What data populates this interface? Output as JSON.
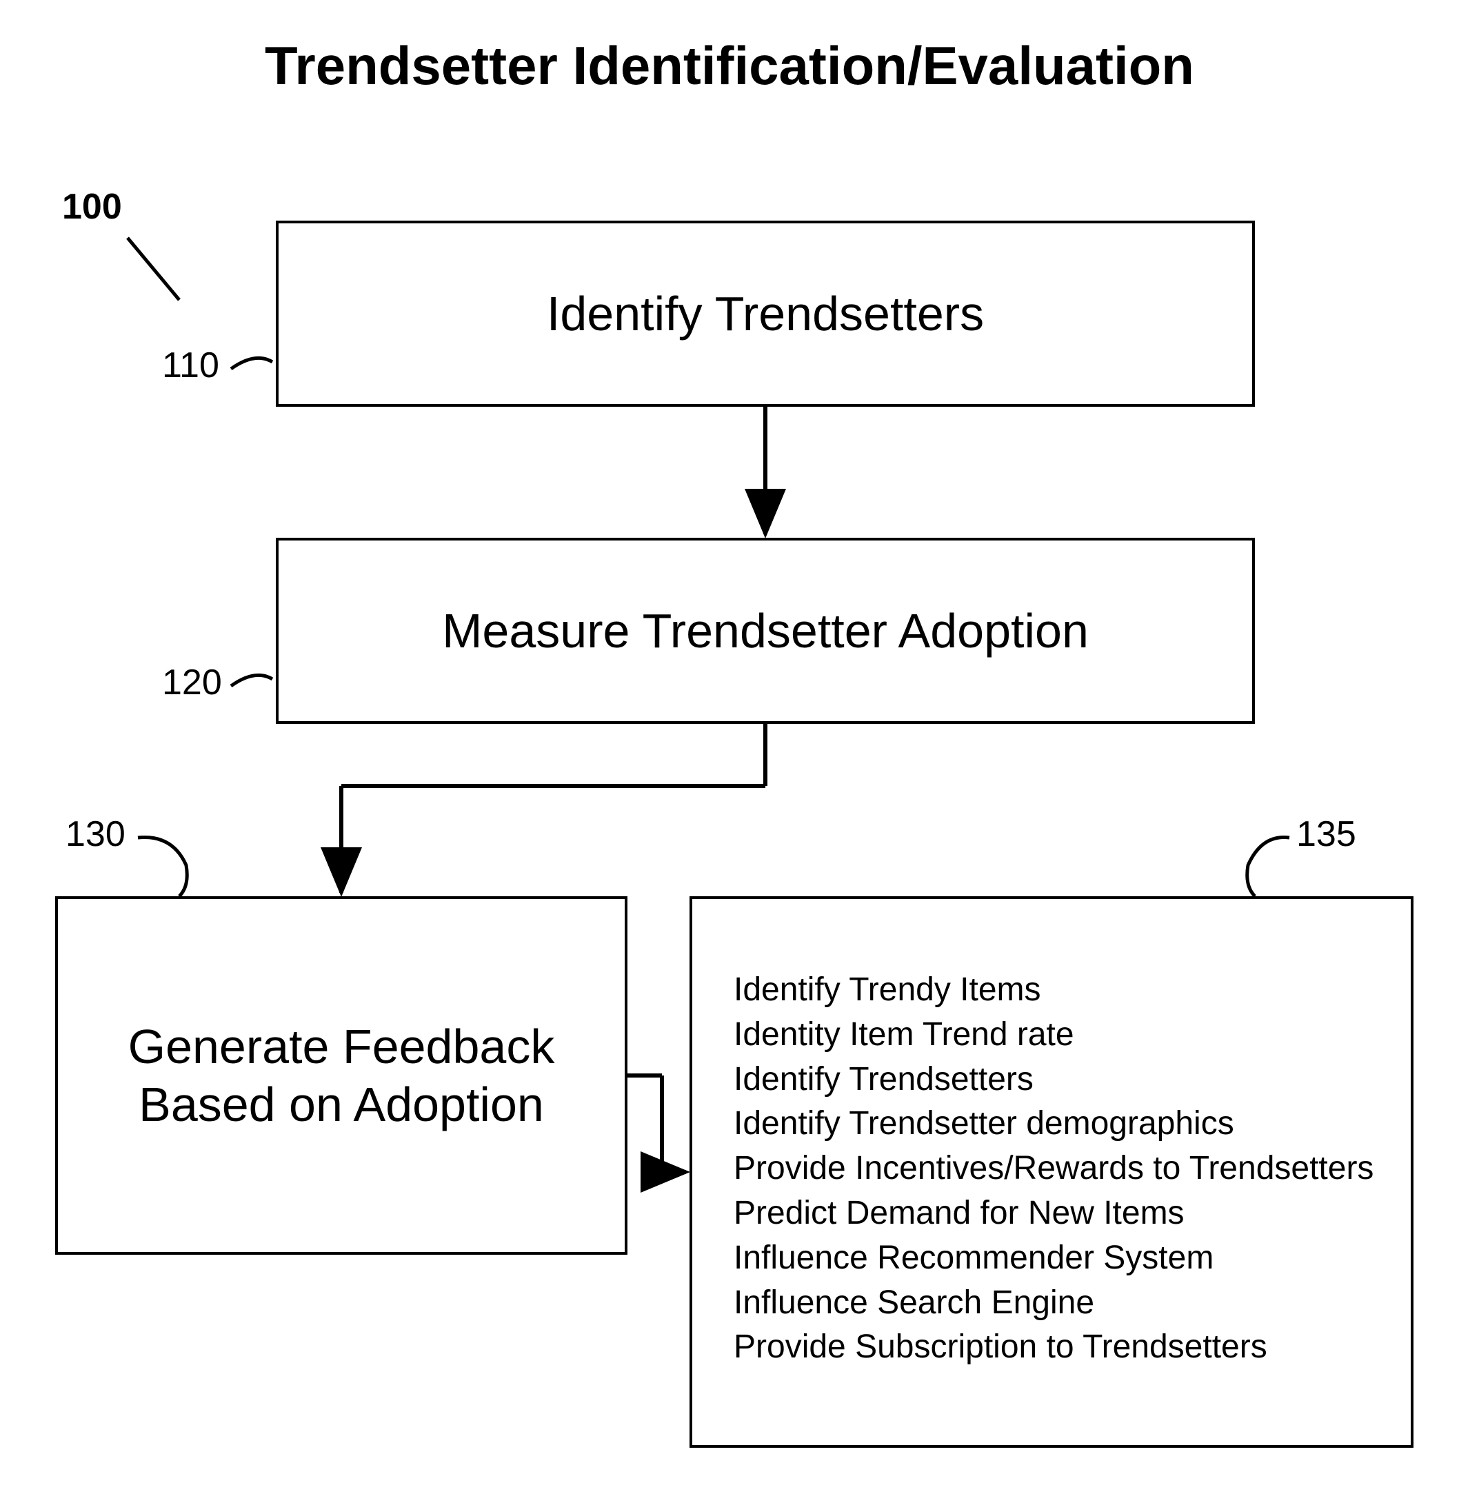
{
  "title": "Trendsetter Identification/Evaluation",
  "refs": {
    "r100": "100",
    "r110": "110",
    "r120": "120",
    "r130": "130",
    "r135": "135"
  },
  "boxes": {
    "identify": "Identify Trendsetters",
    "measure": "Measure Trendsetter Adoption",
    "generate": "Generate Feedback Based on Adoption"
  },
  "list": {
    "i0": "Identify Trendy Items",
    "i1": "Identity Item Trend rate",
    "i2": "Identify Trendsetters",
    "i3": "Identify Trendsetter demographics",
    "i4": "Provide Incentives/Rewards to Trendsetters",
    "i5": "Predict Demand for New Items",
    "i6": "Influence Recommender System",
    "i7": "Influence Search Engine",
    "i8": "Provide Subscription to Trendsetters"
  }
}
